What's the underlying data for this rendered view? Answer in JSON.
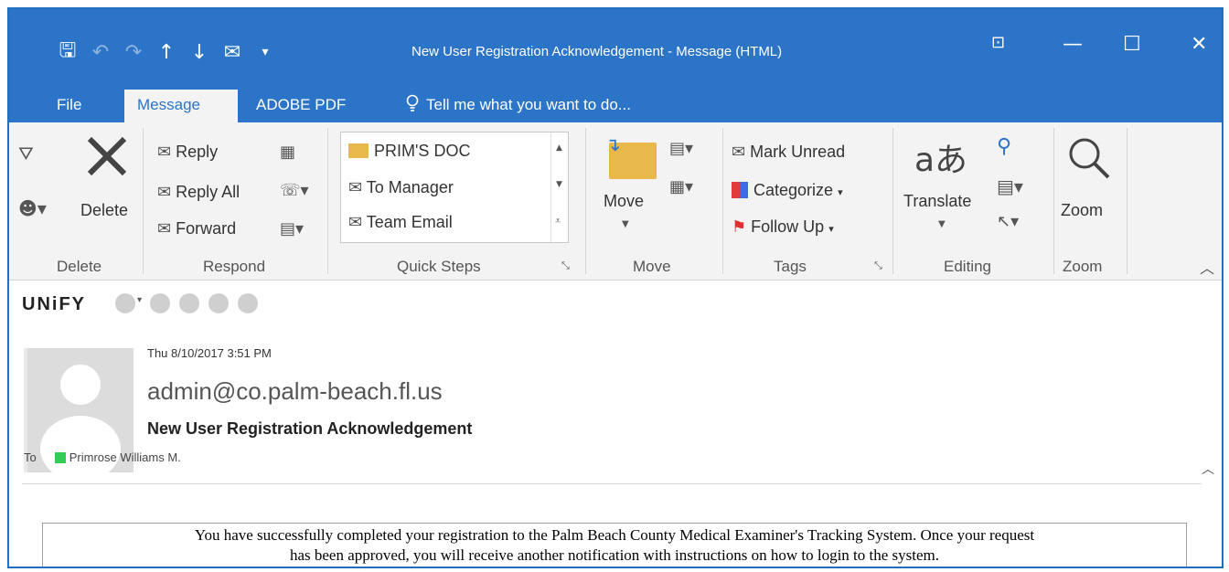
{
  "window": {
    "title": "New User Registration Acknowledgement - Message (HTML)",
    "controls": {
      "ribbon_display": "⊡",
      "minimize": "—",
      "maximize": "☐",
      "close": "✕"
    }
  },
  "quick_access": {
    "save": "🖫",
    "undo": "↶",
    "redo": "↷",
    "up": "↑",
    "down": "↓",
    "reply_icon": "✉",
    "more": "▾"
  },
  "tabs": [
    {
      "label": "File"
    },
    {
      "label": "Message"
    },
    {
      "label": "ADOBE PDF"
    },
    {
      "label": "Tell me what you want to do..."
    }
  ],
  "tell_me_icon": "lightbulb-icon",
  "ribbon": {
    "delete_group": {
      "label": "Delete",
      "delete_button": "Delete"
    },
    "respond_group": {
      "label": "Respond",
      "reply": "Reply",
      "reply_all": "Reply All",
      "forward": "Forward"
    },
    "quick_steps_group": {
      "label": "Quick Steps",
      "items": [
        "PRIM'S DOC",
        "To Manager",
        "Team Email"
      ]
    },
    "move_group": {
      "label": "Move",
      "move_button": "Move"
    },
    "tags_group": {
      "label": "Tags",
      "mark_unread": "Mark Unread",
      "categorize": "Categorize",
      "follow_up": "Follow Up"
    },
    "editing_group": {
      "label": "Editing",
      "translate": "Translate"
    },
    "zoom_group": {
      "label": "Zoom",
      "zoom_button": "Zoom"
    }
  },
  "unify": {
    "brand": "UNiFY"
  },
  "message": {
    "date": "Thu 8/10/2017 3:51 PM",
    "sender": "admin@co.palm-beach.fl.us",
    "subject": "New User Registration Acknowledgement",
    "to_label": "To",
    "to_name": "Primrose Williams M.",
    "body_line1": "You have successfully completed your registration to the Palm Beach County Medical Examiner's Tracking System. Once your request",
    "body_line2": "has been approved, you will receive another notification with instructions on how to login to the system."
  },
  "colors": {
    "accent": "#2b74c8",
    "presence": "#33cc55"
  }
}
